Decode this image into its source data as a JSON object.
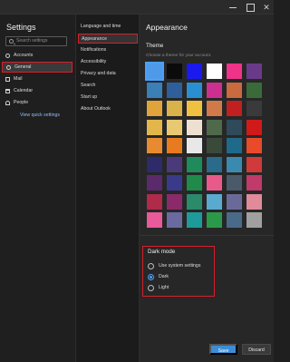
{
  "window": {
    "close_glyph": "✕"
  },
  "left_nav": {
    "title": "Settings",
    "search_placeholder": "Search settings",
    "items": [
      {
        "label": "Accounts",
        "icon": "person-circle-icon",
        "selected": false
      },
      {
        "label": "General",
        "icon": "gear-icon",
        "selected": true
      },
      {
        "label": "Mail",
        "icon": "mail-icon",
        "selected": false
      },
      {
        "label": "Calendar",
        "icon": "calendar-icon",
        "selected": false
      },
      {
        "label": "People",
        "icon": "people-icon",
        "selected": false
      }
    ],
    "view_quick_settings": "View quick settings"
  },
  "sub_nav": {
    "items": [
      {
        "label": "Language and time",
        "selected": false
      },
      {
        "label": "Appearance",
        "selected": true
      },
      {
        "label": "Notifications",
        "selected": false
      },
      {
        "label": "Accessibility",
        "selected": false
      },
      {
        "label": "Privacy and data",
        "selected": false
      },
      {
        "label": "Search",
        "selected": false
      },
      {
        "label": "Start up",
        "selected": false
      },
      {
        "label": "About Outlook",
        "selected": false
      }
    ]
  },
  "appearance": {
    "title": "Appearance",
    "theme_heading": "Theme",
    "theme_subtitle": "Choose a theme for your account.",
    "themes": [
      "#4f9ae8",
      "#0b0b0b",
      "#1a1af0",
      "#ffffff",
      "#ee3388",
      "#6a3a8a",
      "#3a7fb5",
      "#2f5f9a",
      "#2a8fd0",
      "#cc2f8f",
      "#c96a3f",
      "#3a6a3a",
      "#e0a43a",
      "#d9b24a",
      "#f0c040",
      "#d07a4a",
      "#c02020",
      "#3a3a3a",
      "#e2b64a",
      "#e8c870",
      "#ede0d0",
      "#4f6a4a",
      "#2f4a5a",
      "#d01a1a",
      "#e88a30",
      "#e87a20",
      "#e8e8e8",
      "#3a4a3a",
      "#1f6a8a",
      "#e84a2a",
      "#2f2a6a",
      "#4a3a7a",
      "#1f8a5a",
      "#2a6a8a",
      "#3a8ab0",
      "#d03a3a",
      "#5a2a6a",
      "#3a3a8a",
      "#1f8a4a",
      "#e85a8a",
      "#4a5a6a",
      "#c03a6a",
      "#b02a4a",
      "#8a2a6a",
      "#2a8a6a",
      "#5aaad0",
      "#6a6a9a",
      "#e08a9a",
      "#e85a9a",
      "#6a6aa0",
      "#1f9a9a",
      "#2a9a4a",
      "#4a6a8a",
      "#a0a0a0"
    ],
    "dark_mode": {
      "heading": "Dark mode",
      "options": [
        {
          "label": "Use system settings",
          "checked": false
        },
        {
          "label": "Dark",
          "checked": true
        },
        {
          "label": "Light",
          "checked": false
        }
      ]
    },
    "buttons": {
      "save": "Save",
      "discard": "Discard"
    }
  }
}
